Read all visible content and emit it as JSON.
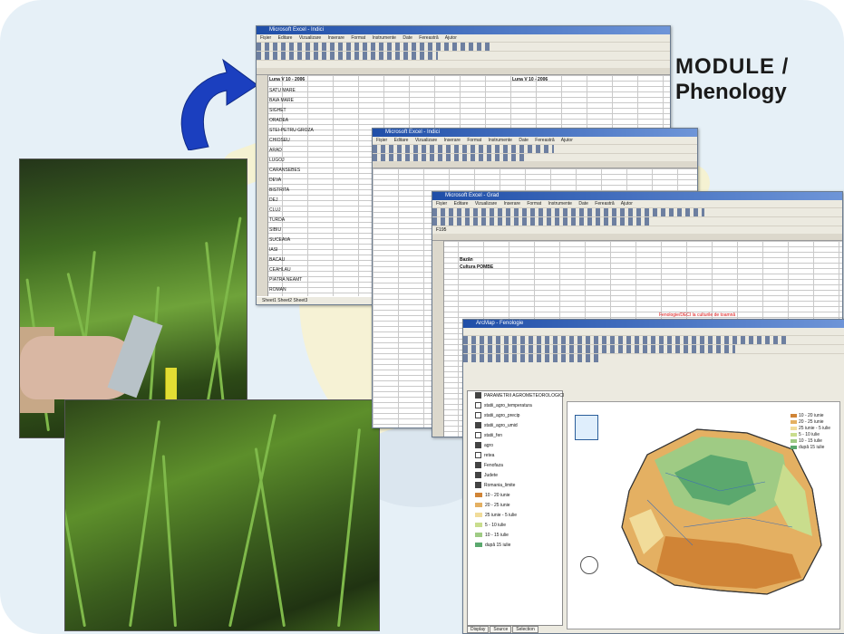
{
  "slide": {
    "title_line1": "MODULE /",
    "title_line2": "Phenology"
  },
  "colors": {
    "background": "#e6f0f7",
    "arrow": "#1b3fbf",
    "excel_titlebar": "#1f4ea8"
  },
  "excel_window_1": {
    "title": "Microsoft Excel - Indici",
    "menu": "Fișier Editare Vizualizare Inserare Format Instrumente Date Fereastră Ajutor",
    "sheet_tabs": "Sheet1  Sheet2  Sheet3",
    "header_left": "Luna V 10 - 2006",
    "header_right": "Luna V 10 - 2006",
    "rows": [
      "SATU MARE",
      "BAIA MARE",
      "SIGHET",
      "ORADEA",
      "STEI-PETRU GROZA",
      "CHIOSEU",
      "ARAD",
      "LUGOJ",
      "CARANSEBES",
      "DEVA",
      "BISTRITA",
      "DEJ",
      "CLUJ",
      "TURDA",
      "SIBIU",
      "SUCEAVA",
      "IASI",
      "BACAU",
      "CEAHLAU",
      "PIATRA NEAMT",
      "ROMAN"
    ]
  },
  "excel_window_2": {
    "title": "Microsoft Excel - Indici",
    "menu": "Fișier Editare Vizualizare Inserare Format Instrumente Date Fereastră Ajutor"
  },
  "excel_window_3": {
    "title": "Microsoft Excel - Grad",
    "menu": "Fișier Editare Vizualizare Inserare Format Instrumente Date Fereastră Ajutor",
    "cell_ref": "F195",
    "label_1": "Bazăn",
    "label_2": "Cultura POMBE",
    "note": "Fenologie/DECI la culturile de toamnă"
  },
  "gis_window": {
    "title": "ArcMap - Fenologie",
    "layers": [
      {
        "label": "PARAMETRII AGROMETEOROLOGICI",
        "checked": true
      },
      {
        "label": "statii_agro_temperatura",
        "checked": false
      },
      {
        "label": "statii_agro_precip",
        "checked": false
      },
      {
        "label": "statii_agro_umid",
        "checked": true
      },
      {
        "label": "statii_fen",
        "checked": false
      },
      {
        "label": "agro",
        "checked": true
      },
      {
        "label": "retea",
        "checked": false
      },
      {
        "label": "Fenofaza",
        "checked": true
      },
      {
        "label": "Judete",
        "checked": true
      },
      {
        "label": "Romania_limite",
        "checked": true
      }
    ],
    "legend_items": [
      {
        "label": "10 - 20 iunie",
        "color": "#d08436"
      },
      {
        "label": "20 - 25 iunie",
        "color": "#e4b062"
      },
      {
        "label": "25 iunie - 5 iulie",
        "color": "#f1dc9a"
      },
      {
        "label": "5 - 10 iulie",
        "color": "#c9dd8d"
      },
      {
        "label": "10 - 15 iulie",
        "color": "#9fcb84"
      },
      {
        "label": "după 15 iulie",
        "color": "#5ba86e"
      }
    ],
    "tabs": [
      "Display",
      "Source",
      "Selection"
    ]
  }
}
